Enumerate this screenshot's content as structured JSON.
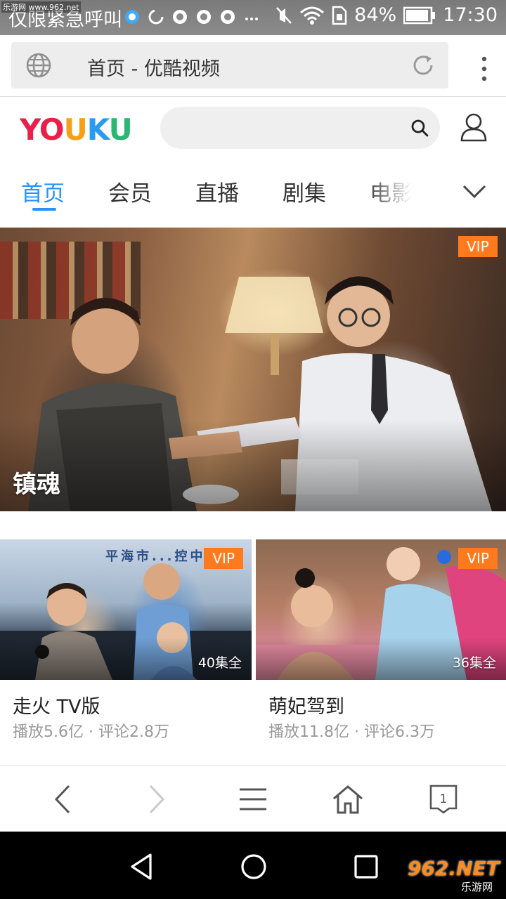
{
  "status_bar": {
    "left_text": "仅限紧急呼叫",
    "battery": "84%",
    "time": "17:30",
    "watermark": "乐游网 www.962.net"
  },
  "browser": {
    "url_title": "首页 - 优酷视频"
  },
  "app": {
    "logo": "YOUKU",
    "logo_colors": [
      "#e8204a",
      "#e8204a",
      "#f6a019",
      "#2b9bf2",
      "#2bb673"
    ],
    "search_placeholder": ""
  },
  "tabs": [
    {
      "label": "首页",
      "active": true
    },
    {
      "label": "会员",
      "active": false
    },
    {
      "label": "直播",
      "active": false
    },
    {
      "label": "剧集",
      "active": false
    },
    {
      "label": "电影",
      "active": false
    }
  ],
  "hero": {
    "title": "镇魂",
    "badge": "VIP"
  },
  "cards": [
    {
      "title": "走火 TV版",
      "meta": "播放5.6亿 · 评论2.8万",
      "episodes": "40集全",
      "badge": "VIP",
      "banner_text": "平海市...控中心"
    },
    {
      "title": "萌妃驾到",
      "meta": "播放11.8亿 · 评论6.3万",
      "episodes": "36集全",
      "badge": "VIP"
    }
  ],
  "toolbar": {
    "tab_count": "1"
  },
  "watermark_bottom": {
    "main": "962.NET",
    "sub": "乐游网"
  },
  "colors": {
    "accent": "#2692ff",
    "vip": "#ff7a1f"
  }
}
